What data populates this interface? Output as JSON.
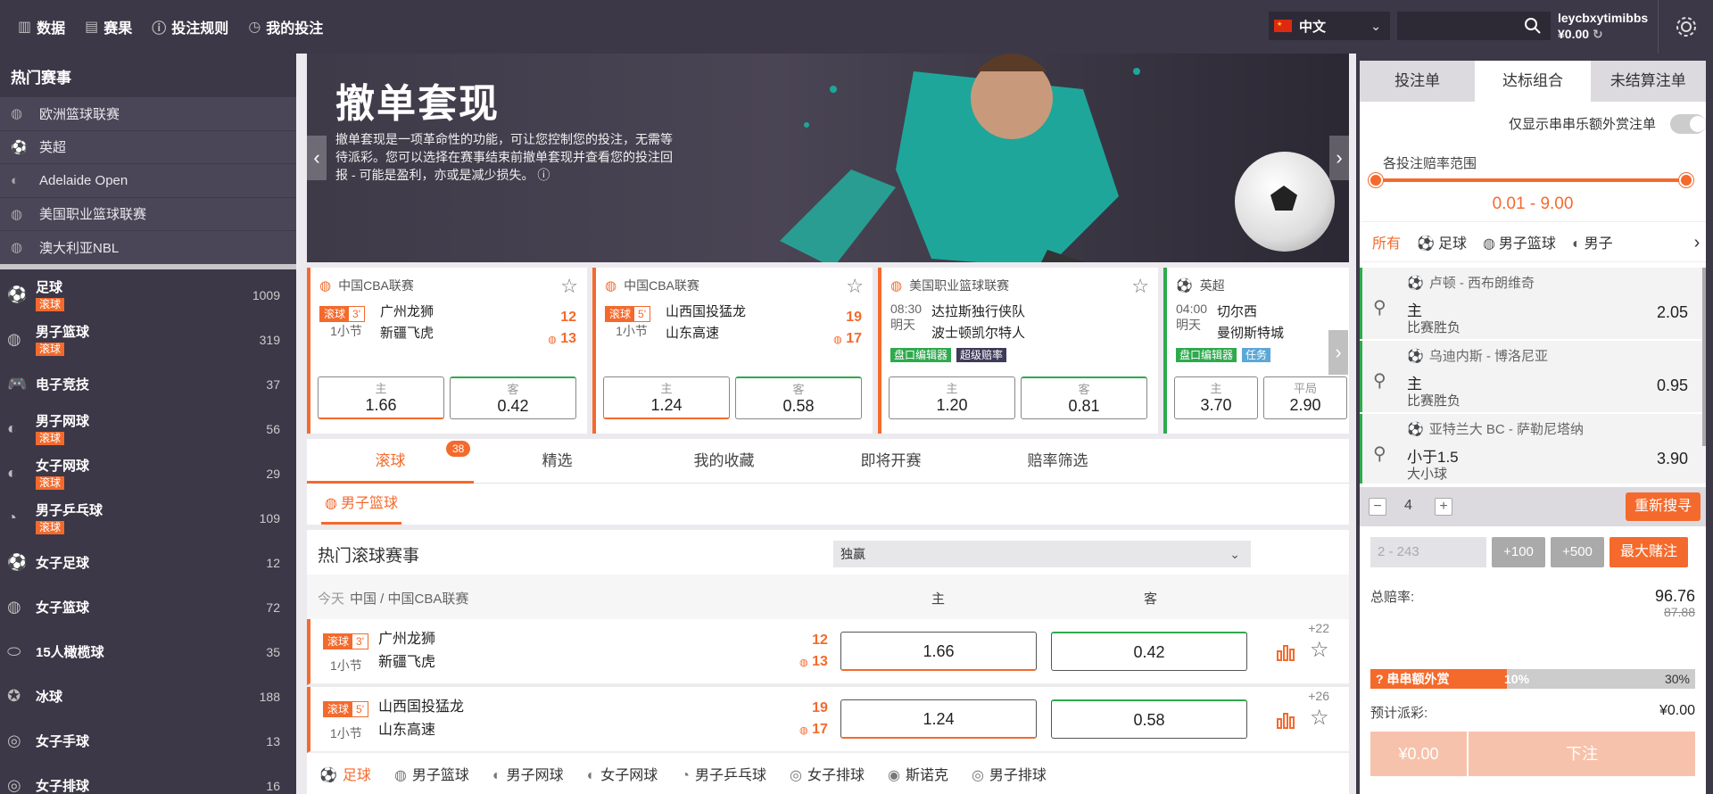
{
  "topnav": [
    {
      "icon": "chart-icon",
      "label": "数据"
    },
    {
      "icon": "scoreboard-icon",
      "label": "赛果"
    },
    {
      "icon": "question-icon",
      "label": "投注规则"
    },
    {
      "icon": "history-icon",
      "label": "我的投注"
    }
  ],
  "lang": {
    "label": "中文"
  },
  "search": {
    "placeholder": ""
  },
  "user": {
    "name": "leycbxytimibbs",
    "balance": "¥0.00"
  },
  "hot": {
    "title": "热门赛事",
    "items": [
      "欧洲篮球联赛",
      "英超",
      "Adelaide Open",
      "美国职业篮球联赛",
      "澳大利亚NBL"
    ]
  },
  "sports": [
    {
      "name": "足球",
      "count": "1009",
      "live": "滚球",
      "icon": "⚽"
    },
    {
      "name": "男子篮球",
      "count": "319",
      "live": "滚球",
      "icon": "◍"
    },
    {
      "name": "电子竞技",
      "count": "37",
      "live": "",
      "icon": "🎮"
    },
    {
      "name": "男子网球",
      "count": "56",
      "live": "滚球",
      "icon": "◐"
    },
    {
      "name": "女子网球",
      "count": "29",
      "live": "滚球",
      "icon": "◐"
    },
    {
      "name": "男子乒乓球",
      "count": "109",
      "live": "滚球",
      "icon": "◔"
    },
    {
      "name": "女子足球",
      "count": "12",
      "live": "",
      "icon": "⚽"
    },
    {
      "name": "女子篮球",
      "count": "72",
      "live": "",
      "icon": "◍"
    },
    {
      "name": "15人橄榄球",
      "count": "35",
      "live": "",
      "icon": "⬭"
    },
    {
      "name": "冰球",
      "count": "188",
      "live": "",
      "icon": "✪"
    },
    {
      "name": "女子手球",
      "count": "13",
      "live": "",
      "icon": "◎"
    },
    {
      "name": "女子排球",
      "count": "16",
      "live": "",
      "icon": "◎"
    }
  ],
  "banner": {
    "title": "撤单套现",
    "desc": "撤单套现是一项革命性的功能，可让您控制您的投注，无需等待派彩。您可以选择在赛事结束前撤单套现并查看您的投注回报 - 可能是盈利，亦或是减少损失。"
  },
  "cards": [
    {
      "league": "中国CBA联赛",
      "live": "滚球",
      "period": "3'",
      "sub": "1小节",
      "home": "广州龙狮",
      "away": "新疆飞虎",
      "s1": "12",
      "s2": "13",
      "o1l": "主",
      "o1": "1.66",
      "o2l": "客",
      "o2": "0.42"
    },
    {
      "league": "中国CBA联赛",
      "live": "滚球",
      "period": "5'",
      "sub": "1小节",
      "home": "山西国投猛龙",
      "away": "山东高速",
      "s1": "19",
      "s2": "17",
      "o1l": "主",
      "o1": "1.24",
      "o2l": "客",
      "o2": "0.58"
    },
    {
      "league": "美国职业篮球联赛",
      "time": "08:30",
      "day": "明天",
      "home": "达拉斯独行侠队",
      "away": "波士顿凯尔特人",
      "tagA": "盘口编辑器",
      "tagB": "超级赔率",
      "o1l": "主",
      "o1": "1.20",
      "o2l": "客",
      "o2": "0.81"
    },
    {
      "league": "英超",
      "time": "04:00",
      "day": "明天",
      "home": "切尔西",
      "away": "曼彻斯特城",
      "tagA": "盘口编辑器",
      "tagB": "任务",
      "o1l": "主",
      "o1": "3.70",
      "o2l": "平局",
      "o2": "2.90"
    }
  ],
  "tabs": {
    "items": [
      "滚球",
      "精选",
      "我的收藏",
      "即将开赛",
      "赔率筛选"
    ],
    "badge": "38"
  },
  "subtab": "男子篮球",
  "hotlive": {
    "title": "热门滚球赛事",
    "select": "独赢"
  },
  "header": {
    "today": "今天",
    "path": "中国 / 中国CBA联赛",
    "col1": "主",
    "col2": "客"
  },
  "matches": [
    {
      "live": "滚球",
      "period": "3'",
      "sub": "1小节",
      "home": "广州龙狮",
      "away": "新疆飞虎",
      "s1": "12",
      "s2": "13",
      "o1": "1.66",
      "o2": "0.42",
      "more": "+22"
    },
    {
      "live": "滚球",
      "period": "5'",
      "sub": "1小节",
      "home": "山西国投猛龙",
      "away": "山东高速",
      "s1": "19",
      "s2": "17",
      "o1": "1.24",
      "o2": "0.58",
      "more": "+26"
    }
  ],
  "sportbar": [
    "足球",
    "男子篮球",
    "男子网球",
    "女子网球",
    "男子乒乓球",
    "女子排球",
    "斯诺克",
    "男子排球"
  ],
  "right": {
    "tabs": [
      "投注单",
      "达标组合",
      "未结算注单"
    ],
    "toggle_label": "仅显示串串乐额外赏注单",
    "range_label": "各投注赔率范围",
    "range_value": "0.01 - 9.00",
    "sports": [
      "所有",
      "足球",
      "男子篮球",
      "男子"
    ],
    "bets": [
      {
        "match": "卢顿 - 西布朗维奇",
        "sel": "主",
        "type": "比赛胜负",
        "odd": "2.05"
      },
      {
        "match": "乌迪内斯 - 博洛尼亚",
        "sel": "主",
        "type": "比赛胜负",
        "odd": "0.95"
      },
      {
        "match": "亚特兰大 BC - 萨勒尼塔纳",
        "sel": "小于1.5",
        "type": "大小球",
        "odd": "3.90"
      }
    ],
    "stake_count": "4",
    "research": "重新搜寻",
    "amount_placeholder": "2 - 243",
    "q100": "+100",
    "q500": "+500",
    "max": "最大赌注",
    "total_odds_label": "总赔率:",
    "total_odds": "96.76",
    "old_odds": "87.88",
    "bonus_label": "串串额外赏",
    "bonus_now": "10%",
    "bonus_max": "30%",
    "bonus_fraction": 0.42,
    "payout_label": "预计派彩:",
    "payout": "¥0.00",
    "btn_amount": "¥0.00",
    "btn_place": "下注"
  }
}
